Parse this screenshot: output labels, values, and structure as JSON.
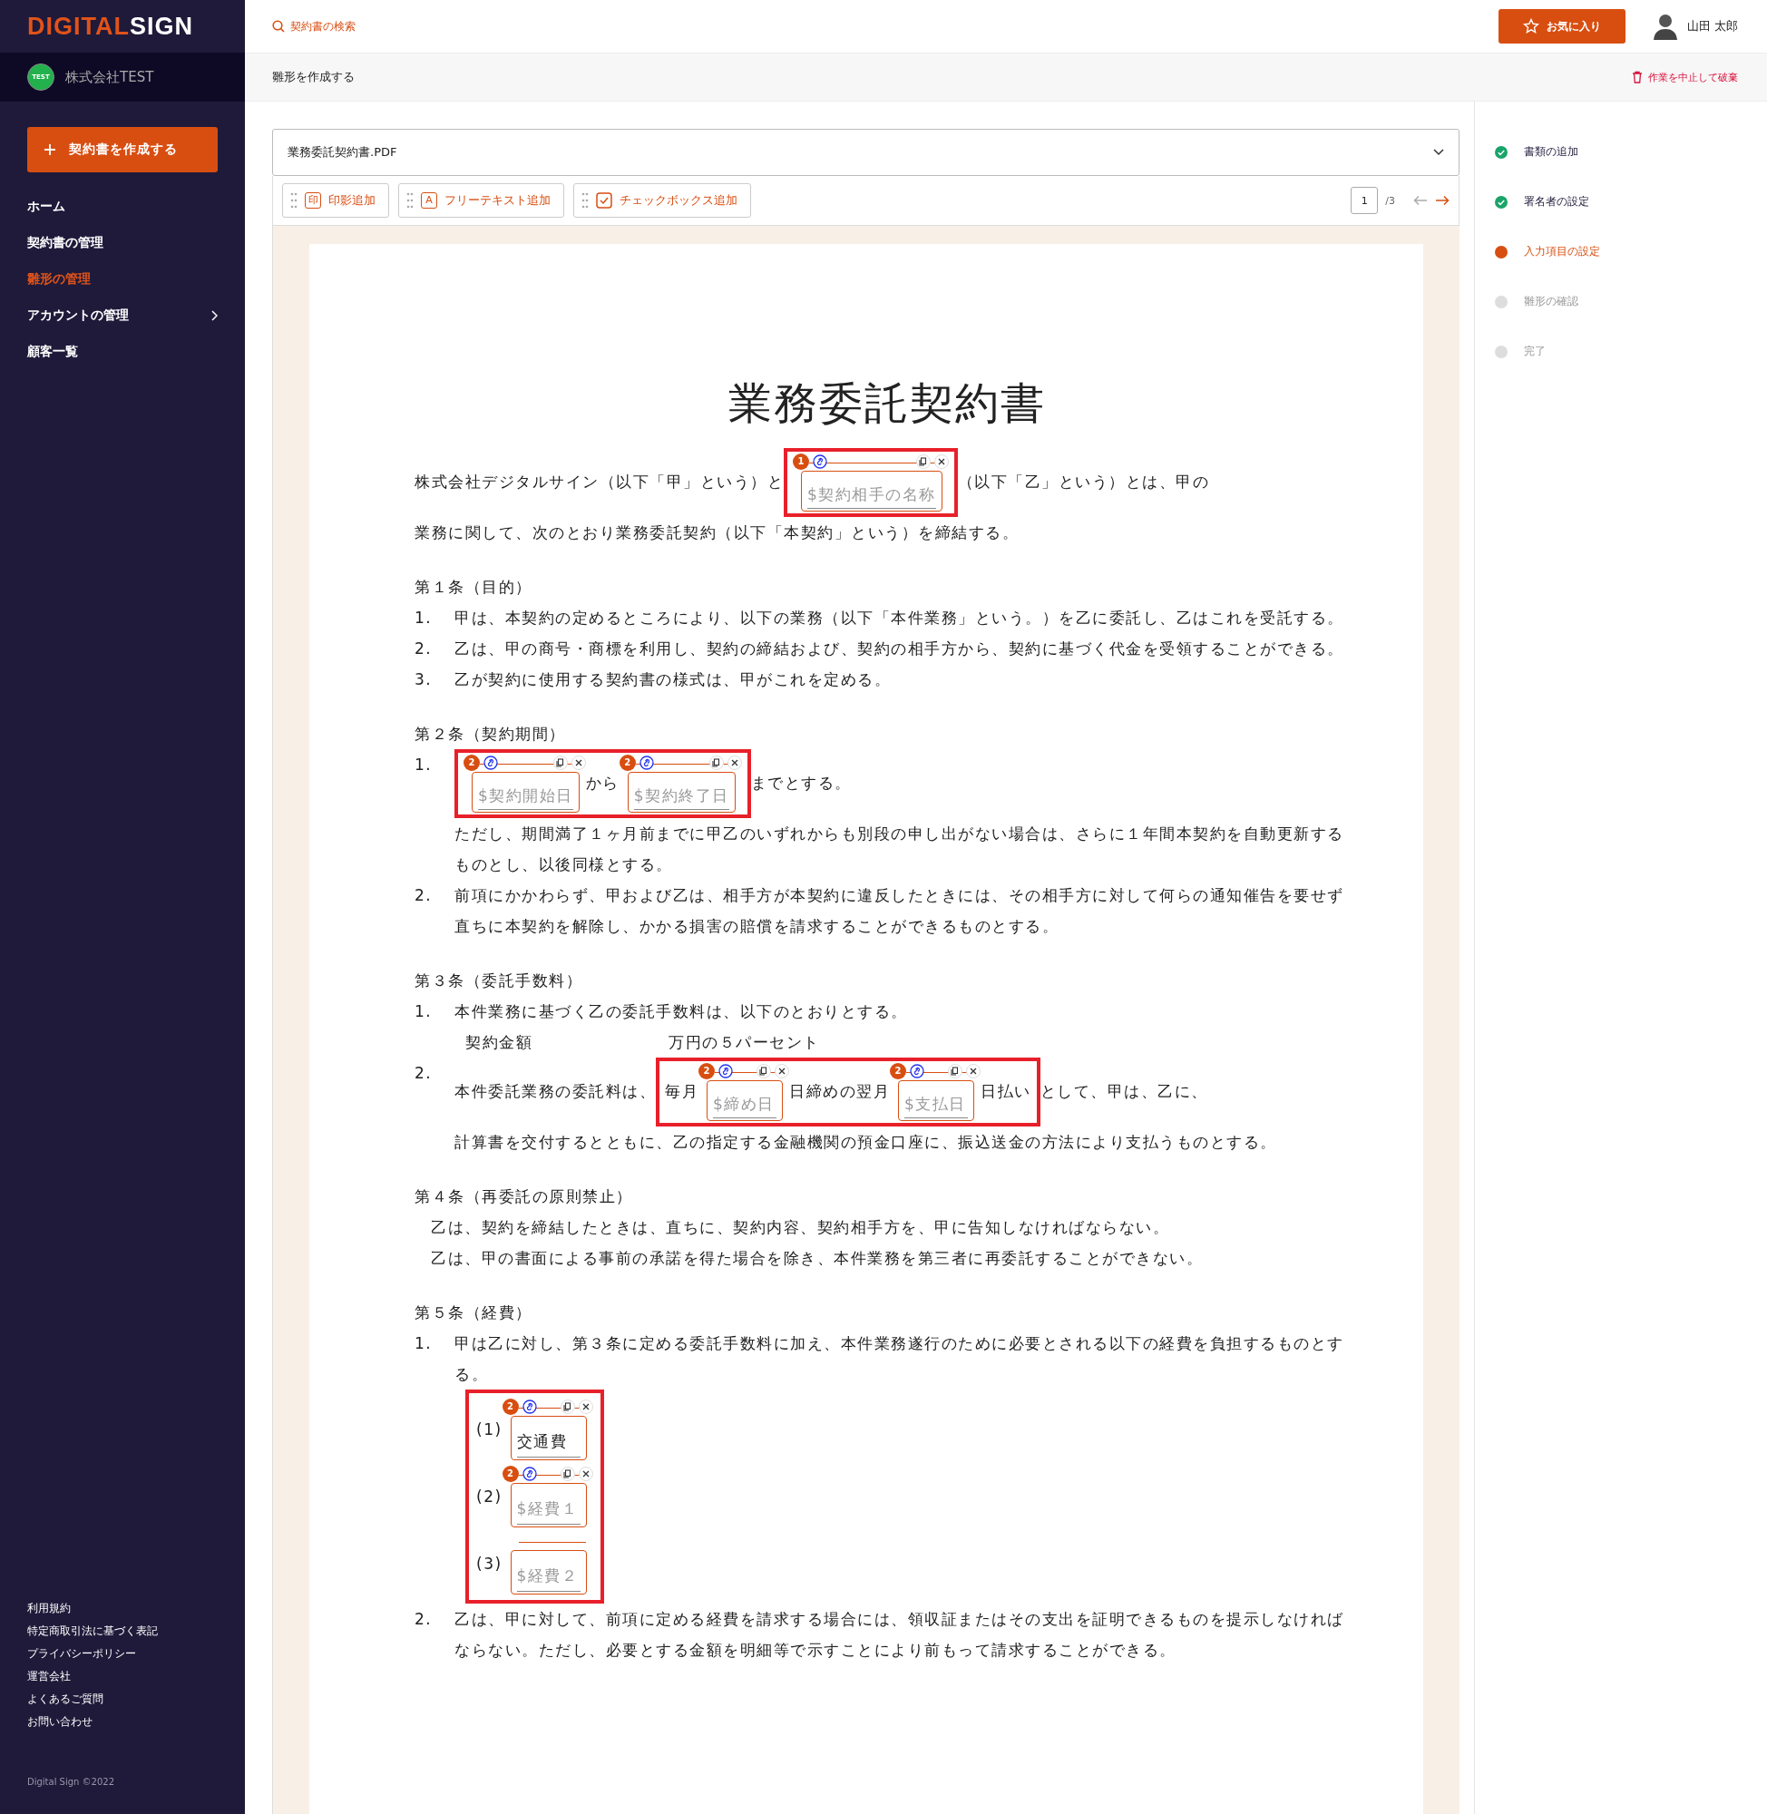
{
  "sidebar": {
    "logo": {
      "accent": "DIGITAL",
      "rest": "SIGN"
    },
    "company": {
      "badge": "TEST",
      "name": "株式会社TEST"
    },
    "create_button": "契約書を作成する",
    "nav": [
      {
        "label": "ホーム",
        "selected": false,
        "expandable": false
      },
      {
        "label": "契約書の管理",
        "selected": false,
        "expandable": false
      },
      {
        "label": "雛形の管理",
        "selected": true,
        "expandable": false
      },
      {
        "label": "アカウントの管理",
        "selected": false,
        "expandable": true
      },
      {
        "label": "顧客一覧",
        "selected": false,
        "expandable": false
      }
    ],
    "footer_links": [
      "利用規約",
      "特定商取引法に基づく表記",
      "プライバシーポリシー",
      "運営会社",
      "よくあるご質問",
      "お問い合わせ"
    ],
    "copyright": "Digital Sign ©2022"
  },
  "header": {
    "search_link": "契約書の検索",
    "favorite_button": "お気に入り",
    "user_name": "山田 太郎"
  },
  "subheader": {
    "title": "雛形を作成する",
    "discard_link": "作業を中止して破棄"
  },
  "file_select": {
    "value": "業務委託契約書.PDF"
  },
  "tools": [
    {
      "kind": "seal",
      "glyph": "印",
      "label": "印影追加"
    },
    {
      "kind": "text",
      "glyph": "A",
      "label": "フリーテキスト追加"
    },
    {
      "kind": "checkbox",
      "label": "チェックボックス追加"
    }
  ],
  "pager": {
    "page": "1",
    "total": "/3",
    "prev_enabled": false,
    "next_enabled": true
  },
  "steps": [
    {
      "label": "書類の追加",
      "completed": true,
      "selected": false
    },
    {
      "label": "署名者の設定",
      "completed": true,
      "selected": false
    },
    {
      "label": "入力項目の設定",
      "completed": false,
      "selected": true
    },
    {
      "label": "雛形の確認",
      "completed": false,
      "selected": false
    },
    {
      "label": "完了",
      "completed": false,
      "selected": false
    }
  ],
  "document": {
    "title": "業務委託契約書",
    "blocks": [
      {
        "kind": "para",
        "lines": [
          [
            {
              "kind": "text",
              "text": "株式会社デジタルサイン（以下「甲」という）と"
            },
            {
              "kind": "group",
              "selected": true,
              "segments": [
                {
                  "kind": "field",
                  "signer": "1",
                  "placeholder": "$契約相手の名称"
                }
              ]
            },
            {
              "kind": "text",
              "text": "（以下「乙」という）とは、甲の"
            }
          ],
          [
            {
              "kind": "text",
              "text": "業務に関して、次のとおり業務委託契約（以下「本契約」という）を締結する。"
            }
          ]
        ]
      },
      {
        "kind": "heading",
        "text": "第１条（目的）"
      },
      {
        "kind": "item",
        "number": "1.",
        "text": "甲は、本契約の定めるところにより、以下の業務（以下「本件業務」という。）を乙に委託し、乙はこれを受託する。"
      },
      {
        "kind": "item",
        "number": "2.",
        "text": "乙は、甲の商号・商標を利用し、契約の締結および、契約の相手方から、契約に基づく代金を受領することができる。"
      },
      {
        "kind": "item",
        "number": "3.",
        "text": "乙が契約に使用する契約書の様式は、甲がこれを定める。"
      },
      {
        "kind": "heading",
        "text": "第２条（契約期間）"
      },
      {
        "kind": "item",
        "number": "1.",
        "lines": [
          [
            {
              "kind": "group",
              "selected": true,
              "segments": [
                {
                  "kind": "field",
                  "signer": "2",
                  "placeholder": "$契約開始日"
                },
                {
                  "kind": "text",
                  "text": "から"
                },
                {
                  "kind": "field",
                  "signer": "2",
                  "placeholder": "$契約終了日"
                }
              ]
            },
            {
              "kind": "text",
              "text": "までとする。"
            }
          ]
        ]
      },
      {
        "kind": "note",
        "text": "ただし、期間満了１ヶ月前までに甲乙のいずれからも別段の申し出がない場合は、さらに１年間本契約を自動更新するものとし、以後同様とする。"
      },
      {
        "kind": "item",
        "number": "2.",
        "text": "前項にかかわらず、甲および乙は、相手方が本契約に違反したときには、その相手方に対して何らの通知催告を要せず直ちに本契約を解除し、かかる損害の賠償を請求することができるものとする。"
      },
      {
        "kind": "heading",
        "text": "第３条（委託手数料）"
      },
      {
        "kind": "item",
        "number": "1.",
        "text": "本件業務に基づく乙の委託手数料は、以下のとおりとする。"
      },
      {
        "kind": "pair",
        "left": "契約金額",
        "right": "万円の５パーセント"
      },
      {
        "kind": "item",
        "number": "2.",
        "lines": [
          [
            {
              "kind": "text",
              "text": "本件委託業務の委託料は、"
            },
            {
              "kind": "group",
              "selected": true,
              "segments": [
                {
                  "kind": "text",
                  "text": "毎月"
                },
                {
                  "kind": "field",
                  "signer": "2",
                  "placeholder": "$締め日"
                },
                {
                  "kind": "text",
                  "text": "日締めの翌月"
                },
                {
                  "kind": "field",
                  "signer": "2",
                  "placeholder": "$支払日"
                },
                {
                  "kind": "text",
                  "text": "日払い"
                }
              ]
            },
            {
              "kind": "text",
              "text": "として、甲は、乙に、"
            }
          ],
          [
            {
              "kind": "text",
              "text": "計算書を交付するとともに、乙の指定する金融機関の預金口座に、振込送金の方法により支払うものとする。"
            }
          ]
        ]
      },
      {
        "kind": "heading",
        "text": "第４条（再委託の原則禁止）"
      },
      {
        "kind": "plain",
        "text": "乙は、契約を締結したときは、直ちに、契約内容、契約相手方を、甲に告知しなければならない。"
      },
      {
        "kind": "plain",
        "text": "乙は、甲の書面による事前の承諾を得た場合を除き、本件業務を第三者に再委託することができない。"
      },
      {
        "kind": "heading",
        "text": "第５条（経費）"
      },
      {
        "kind": "item",
        "number": "1.",
        "text": "甲は乙に対し、第３条に定める委託手数料に加え、本件業務遂行のために必要とされる以下の経費を負担するものとする。"
      },
      {
        "kind": "sublist",
        "selected": true,
        "items": [
          {
            "number": "(1)",
            "field": {
              "signer": "2",
              "value": "交通費"
            }
          },
          {
            "number": "(2)",
            "field": {
              "signer": "2",
              "placeholder": "$経費１"
            }
          },
          {
            "number": "(3)",
            "field": {
              "placeholder": "$経費２"
            }
          }
        ]
      },
      {
        "kind": "item",
        "number": "2.",
        "text": "乙は、甲に対して、前項に定める経費を請求する場合には、領収証またはその支出を証明できるものを提示しなければならない。ただし、必要とする金額を明細等で示すことにより前もって請求することができる。"
      }
    ]
  }
}
